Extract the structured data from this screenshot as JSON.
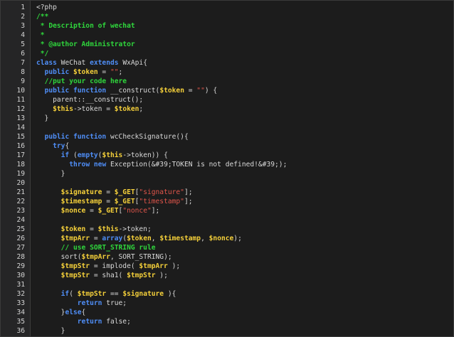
{
  "editor": {
    "language": "php",
    "colors": {
      "background": "#1c1c1c",
      "gutter": "#252526",
      "keyword": "#4f8ef7",
      "variable": "#f5d03a",
      "comment": "#2fd63c",
      "string": "#e0554a",
      "plain": "#d8d8d8"
    },
    "lines": [
      {
        "n": "1",
        "indent": 0,
        "tokens": [
          {
            "t": "pl",
            "v": "<?php"
          }
        ]
      },
      {
        "n": "2",
        "indent": 0,
        "tokens": [
          {
            "t": "cm",
            "v": "/**"
          }
        ]
      },
      {
        "n": "3",
        "indent": 0,
        "tokens": [
          {
            "t": "cm",
            "v": " * Description of wechat"
          }
        ]
      },
      {
        "n": "4",
        "indent": 0,
        "tokens": [
          {
            "t": "cm",
            "v": " *"
          }
        ]
      },
      {
        "n": "5",
        "indent": 0,
        "tokens": [
          {
            "t": "cm",
            "v": " * @author Administrator"
          }
        ]
      },
      {
        "n": "6",
        "indent": 0,
        "tokens": [
          {
            "t": "cm",
            "v": " */"
          }
        ]
      },
      {
        "n": "7",
        "indent": 0,
        "tokens": [
          {
            "t": "kw",
            "v": "class"
          },
          {
            "t": "pl",
            "v": " WeChat "
          },
          {
            "t": "kw",
            "v": "extends"
          },
          {
            "t": "pl",
            "v": " WxApi{"
          }
        ]
      },
      {
        "n": "8",
        "indent": 0,
        "tokens": [
          {
            "t": "pl",
            "v": "  "
          },
          {
            "t": "kw",
            "v": "public"
          },
          {
            "t": "pl",
            "v": " "
          },
          {
            "t": "var",
            "v": "$token"
          },
          {
            "t": "pl",
            "v": " = "
          },
          {
            "t": "str",
            "v": "\"\""
          },
          {
            "t": "pl",
            "v": ";"
          }
        ]
      },
      {
        "n": "9",
        "indent": 0,
        "tokens": [
          {
            "t": "pl",
            "v": "  "
          },
          {
            "t": "cm",
            "v": "//put your code here"
          }
        ]
      },
      {
        "n": "10",
        "indent": 0,
        "tokens": [
          {
            "t": "pl",
            "v": "  "
          },
          {
            "t": "kw",
            "v": "public"
          },
          {
            "t": "pl",
            "v": " "
          },
          {
            "t": "kw",
            "v": "function"
          },
          {
            "t": "pl",
            "v": " __construct("
          },
          {
            "t": "var",
            "v": "$token"
          },
          {
            "t": "pl",
            "v": " = "
          },
          {
            "t": "str",
            "v": "\"\""
          },
          {
            "t": "pl",
            "v": ") {"
          }
        ]
      },
      {
        "n": "11",
        "indent": 0,
        "tokens": [
          {
            "t": "pl",
            "v": "    parent::__construct();"
          }
        ]
      },
      {
        "n": "12",
        "indent": 0,
        "tokens": [
          {
            "t": "pl",
            "v": "    "
          },
          {
            "t": "var",
            "v": "$this"
          },
          {
            "t": "pl",
            "v": "->token = "
          },
          {
            "t": "var",
            "v": "$token"
          },
          {
            "t": "pl",
            "v": ";"
          }
        ]
      },
      {
        "n": "13",
        "indent": 0,
        "tokens": [
          {
            "t": "pl",
            "v": "  }"
          }
        ]
      },
      {
        "n": "14",
        "indent": 0,
        "tokens": []
      },
      {
        "n": "15",
        "indent": 0,
        "tokens": [
          {
            "t": "pl",
            "v": "  "
          },
          {
            "t": "kw",
            "v": "public"
          },
          {
            "t": "pl",
            "v": " "
          },
          {
            "t": "kw",
            "v": "function"
          },
          {
            "t": "pl",
            "v": " wcCheckSignature(){"
          }
        ]
      },
      {
        "n": "16",
        "indent": 0,
        "tokens": [
          {
            "t": "pl",
            "v": "    "
          },
          {
            "t": "kw",
            "v": "try"
          },
          {
            "t": "pl",
            "v": "{"
          }
        ]
      },
      {
        "n": "17",
        "indent": 0,
        "tokens": [
          {
            "t": "pl",
            "v": "      "
          },
          {
            "t": "kw",
            "v": "if"
          },
          {
            "t": "pl",
            "v": " ("
          },
          {
            "t": "kw",
            "v": "empty"
          },
          {
            "t": "pl",
            "v": "("
          },
          {
            "t": "var",
            "v": "$this"
          },
          {
            "t": "pl",
            "v": "->token)) {"
          }
        ]
      },
      {
        "n": "18",
        "indent": 0,
        "tokens": [
          {
            "t": "pl",
            "v": "        "
          },
          {
            "t": "kw",
            "v": "throw"
          },
          {
            "t": "pl",
            "v": " "
          },
          {
            "t": "kw",
            "v": "new"
          },
          {
            "t": "pl",
            "v": " Exception(&#39;TOKEN is not defined!&#39;);"
          }
        ]
      },
      {
        "n": "19",
        "indent": 0,
        "tokens": [
          {
            "t": "pl",
            "v": "      }"
          }
        ]
      },
      {
        "n": "20",
        "indent": 0,
        "tokens": []
      },
      {
        "n": "21",
        "indent": 0,
        "tokens": [
          {
            "t": "pl",
            "v": "      "
          },
          {
            "t": "var",
            "v": "$signature"
          },
          {
            "t": "pl",
            "v": " = "
          },
          {
            "t": "var",
            "v": "$_GET"
          },
          {
            "t": "pl",
            "v": "["
          },
          {
            "t": "str",
            "v": "\"signature\""
          },
          {
            "t": "pl",
            "v": "];"
          }
        ]
      },
      {
        "n": "22",
        "indent": 0,
        "tokens": [
          {
            "t": "pl",
            "v": "      "
          },
          {
            "t": "var",
            "v": "$timestamp"
          },
          {
            "t": "pl",
            "v": " = "
          },
          {
            "t": "var",
            "v": "$_GET"
          },
          {
            "t": "pl",
            "v": "["
          },
          {
            "t": "str",
            "v": "\"timestamp\""
          },
          {
            "t": "pl",
            "v": "];"
          }
        ]
      },
      {
        "n": "23",
        "indent": 0,
        "tokens": [
          {
            "t": "pl",
            "v": "      "
          },
          {
            "t": "var",
            "v": "$nonce"
          },
          {
            "t": "pl",
            "v": " = "
          },
          {
            "t": "var",
            "v": "$_GET"
          },
          {
            "t": "pl",
            "v": "["
          },
          {
            "t": "str",
            "v": "\"nonce\""
          },
          {
            "t": "pl",
            "v": "];"
          }
        ]
      },
      {
        "n": "24",
        "indent": 0,
        "tokens": []
      },
      {
        "n": "25",
        "indent": 0,
        "tokens": [
          {
            "t": "pl",
            "v": "      "
          },
          {
            "t": "var",
            "v": "$token"
          },
          {
            "t": "pl",
            "v": " = "
          },
          {
            "t": "var",
            "v": "$this"
          },
          {
            "t": "pl",
            "v": "->token;"
          }
        ]
      },
      {
        "n": "26",
        "indent": 0,
        "tokens": [
          {
            "t": "pl",
            "v": "      "
          },
          {
            "t": "var",
            "v": "$tmpArr"
          },
          {
            "t": "pl",
            "v": " = "
          },
          {
            "t": "kw",
            "v": "array"
          },
          {
            "t": "pl",
            "v": "("
          },
          {
            "t": "var",
            "v": "$token"
          },
          {
            "t": "pl",
            "v": ", "
          },
          {
            "t": "var",
            "v": "$timestamp"
          },
          {
            "t": "pl",
            "v": ", "
          },
          {
            "t": "var",
            "v": "$nonce"
          },
          {
            "t": "pl",
            "v": ");"
          }
        ]
      },
      {
        "n": "27",
        "indent": 0,
        "tokens": [
          {
            "t": "pl",
            "v": "      "
          },
          {
            "t": "cm",
            "v": "// use SORT_STRING rule"
          }
        ]
      },
      {
        "n": "28",
        "indent": 0,
        "tokens": [
          {
            "t": "pl",
            "v": "      sort("
          },
          {
            "t": "var",
            "v": "$tmpArr"
          },
          {
            "t": "pl",
            "v": ", SORT_STRING);"
          }
        ]
      },
      {
        "n": "29",
        "indent": 0,
        "tokens": [
          {
            "t": "pl",
            "v": "      "
          },
          {
            "t": "var",
            "v": "$tmpStr"
          },
          {
            "t": "pl",
            "v": " = implode( "
          },
          {
            "t": "var",
            "v": "$tmpArr"
          },
          {
            "t": "pl",
            "v": " );"
          }
        ]
      },
      {
        "n": "30",
        "indent": 0,
        "tokens": [
          {
            "t": "pl",
            "v": "      "
          },
          {
            "t": "var",
            "v": "$tmpStr"
          },
          {
            "t": "pl",
            "v": " = sha1( "
          },
          {
            "t": "var",
            "v": "$tmpStr"
          },
          {
            "t": "pl",
            "v": " );"
          }
        ]
      },
      {
        "n": "31",
        "indent": 0,
        "tokens": []
      },
      {
        "n": "32",
        "indent": 0,
        "tokens": [
          {
            "t": "pl",
            "v": "      "
          },
          {
            "t": "kw",
            "v": "if"
          },
          {
            "t": "pl",
            "v": "( "
          },
          {
            "t": "var",
            "v": "$tmpStr"
          },
          {
            "t": "pl",
            "v": " == "
          },
          {
            "t": "var",
            "v": "$signature"
          },
          {
            "t": "pl",
            "v": " ){"
          }
        ]
      },
      {
        "n": "33",
        "indent": 0,
        "tokens": [
          {
            "t": "pl",
            "v": "          "
          },
          {
            "t": "kw",
            "v": "return"
          },
          {
            "t": "pl",
            "v": " true;"
          }
        ]
      },
      {
        "n": "34",
        "indent": 0,
        "tokens": [
          {
            "t": "pl",
            "v": "      }"
          },
          {
            "t": "kw",
            "v": "else"
          },
          {
            "t": "pl",
            "v": "{"
          }
        ]
      },
      {
        "n": "35",
        "indent": 0,
        "tokens": [
          {
            "t": "pl",
            "v": "          "
          },
          {
            "t": "kw",
            "v": "return"
          },
          {
            "t": "pl",
            "v": " false;"
          }
        ]
      },
      {
        "n": "36",
        "indent": 0,
        "tokens": [
          {
            "t": "pl",
            "v": "      }"
          }
        ]
      }
    ]
  }
}
